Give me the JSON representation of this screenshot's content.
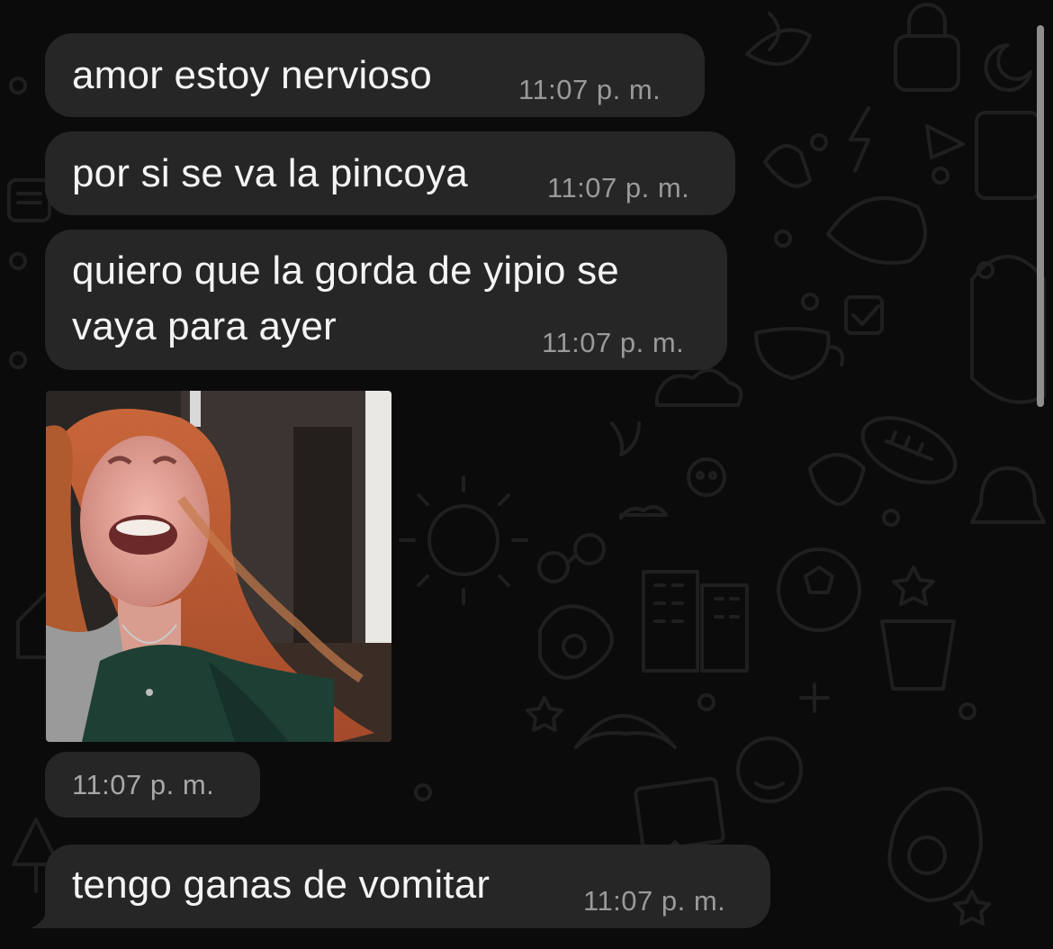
{
  "chat": {
    "messages": [
      {
        "text": "amor estoy nervioso",
        "time": "11:07 p. m."
      },
      {
        "text": "por si se va la pincoya",
        "time": "11:07 p. m."
      },
      {
        "text_line1": "quiero que la gorda de yipio se",
        "text_line2": "vaya para ayer",
        "time": "11:07 p. m."
      },
      {
        "media": "sticker-laughing-woman",
        "time": "11:07 p. m."
      },
      {
        "text": "tengo ganas de vomitar",
        "time": "11:07 p. m."
      }
    ]
  },
  "colors": {
    "background": "#0b0b0b",
    "bubble": "#262626",
    "text": "#f4f4f4",
    "timestamp": "#9a9a9a",
    "wallpaper_doodles": "#1e1e1e"
  }
}
